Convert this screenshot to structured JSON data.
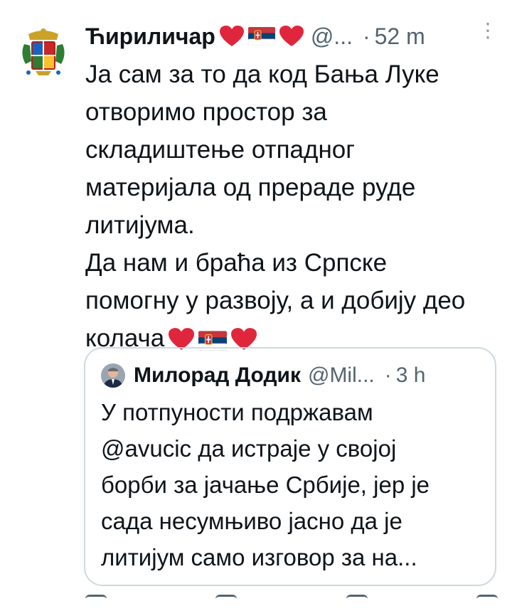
{
  "tweet": {
    "author_name": "Ћириличар",
    "handle": "@...",
    "dot": "·",
    "time": "52 m",
    "more": "⋮",
    "text_lines": [
      "Ја сам за то да код Бања Луке",
      "отворимо простор за",
      "складиштење отпадног",
      "материјала од прераде руде",
      "литијума.",
      "Да нам и браћа из Српске",
      "помогну у развоју, а и добију део",
      "колача"
    ],
    "icons": {
      "avatar": "coat-of-arms-icon",
      "emoji_sequence": [
        "red-heart-icon",
        "serbia-flag-icon",
        "red-heart-icon"
      ],
      "more": "more-options-icon"
    }
  },
  "quote": {
    "author_name": "Милорад Додик",
    "handle": "@Mil...",
    "dot": "·",
    "time": "3 h",
    "text_lines": [
      "У потпуности подржавам",
      "@avucic да истраје у својој",
      "борби за јачање Србије, јер је",
      "сада несумњиво јасно да је",
      "литијум само изговор за на..."
    ]
  },
  "colors": {
    "text": "#0f1419",
    "secondary": "#536471",
    "border": "#cfd9de",
    "heart": "#e0263d",
    "flag_red": "#c6363c",
    "flag_blue": "#0c4076",
    "flag_white": "#ffffff"
  }
}
